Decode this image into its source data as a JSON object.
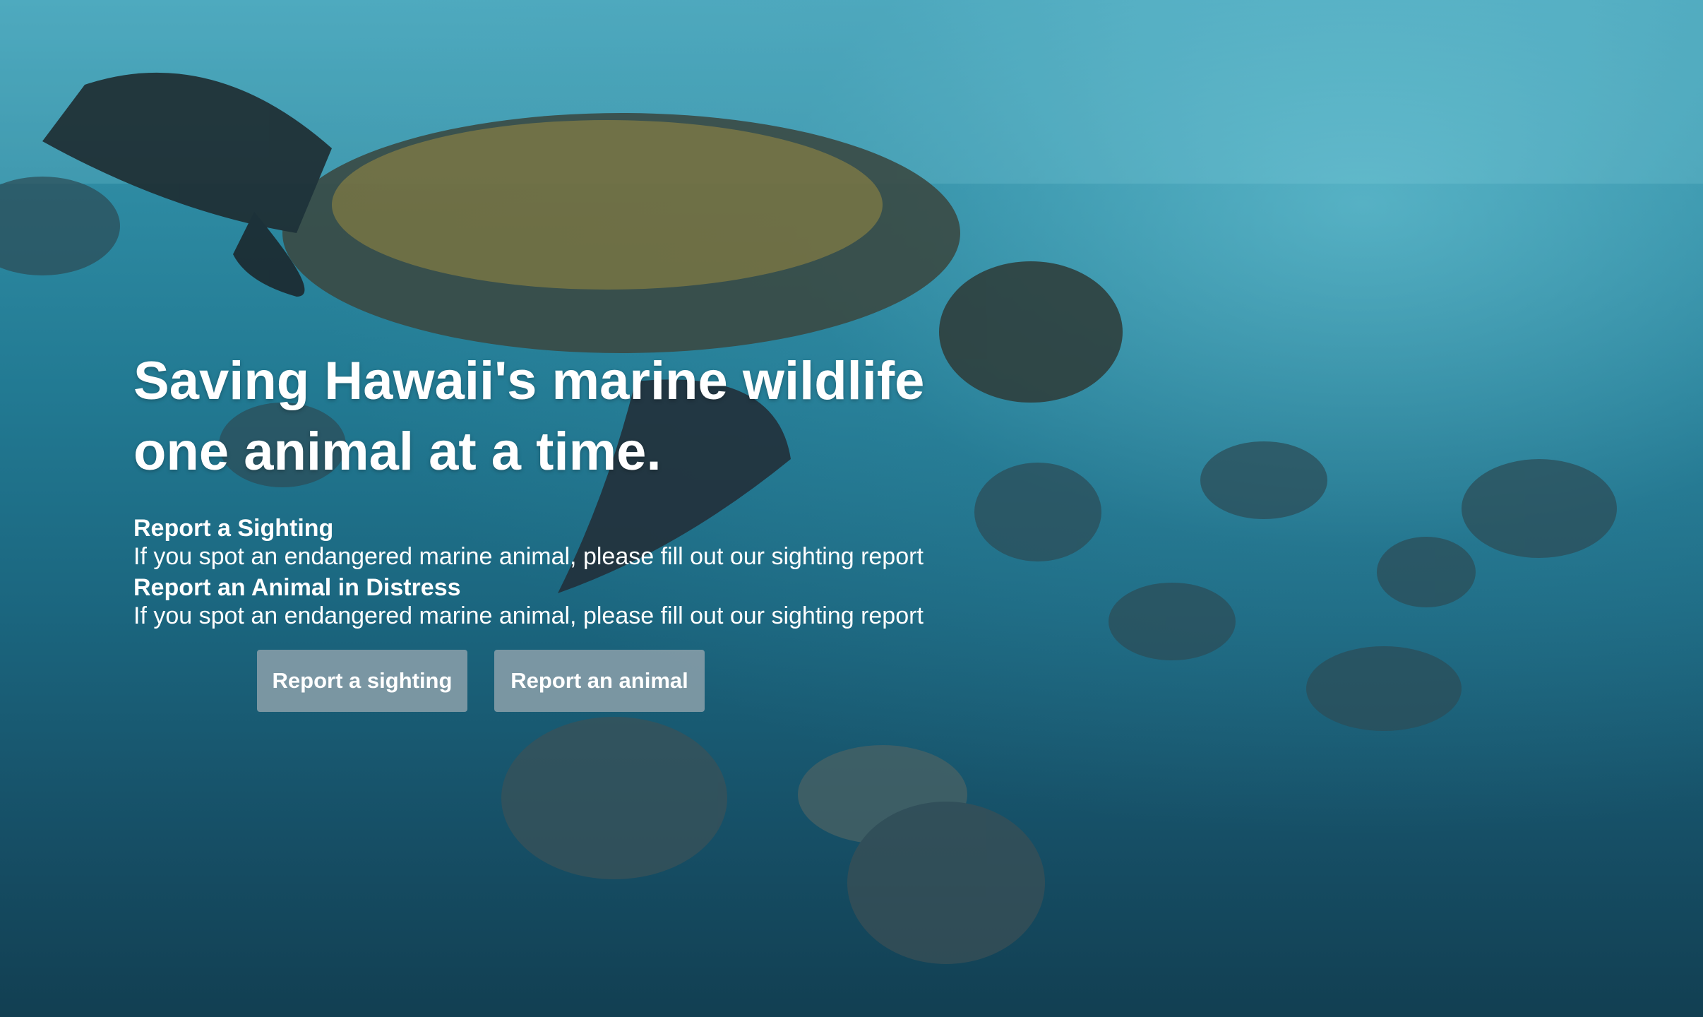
{
  "hero": {
    "headline_line1": "Saving Hawaii's marine wildlife",
    "headline_line2": "one animal at a time.",
    "background": "underwater-sea-turtle-and-fish-photo"
  },
  "sections": [
    {
      "title": "Report a Sighting",
      "text": "If you spot an endangered marine animal, please fill out our sighting report"
    },
    {
      "title": "Report an Animal in Distress",
      "text": "If you spot an endangered marine animal, please fill out our sighting report"
    }
  ],
  "buttons": {
    "sighting_label": "Report a sighting",
    "animal_label": "Report an animal"
  },
  "colors": {
    "water_top": "#3f9fb6",
    "water_bottom": "#123f52",
    "button_bg": "#8ca0aa",
    "text": "#ffffff"
  }
}
